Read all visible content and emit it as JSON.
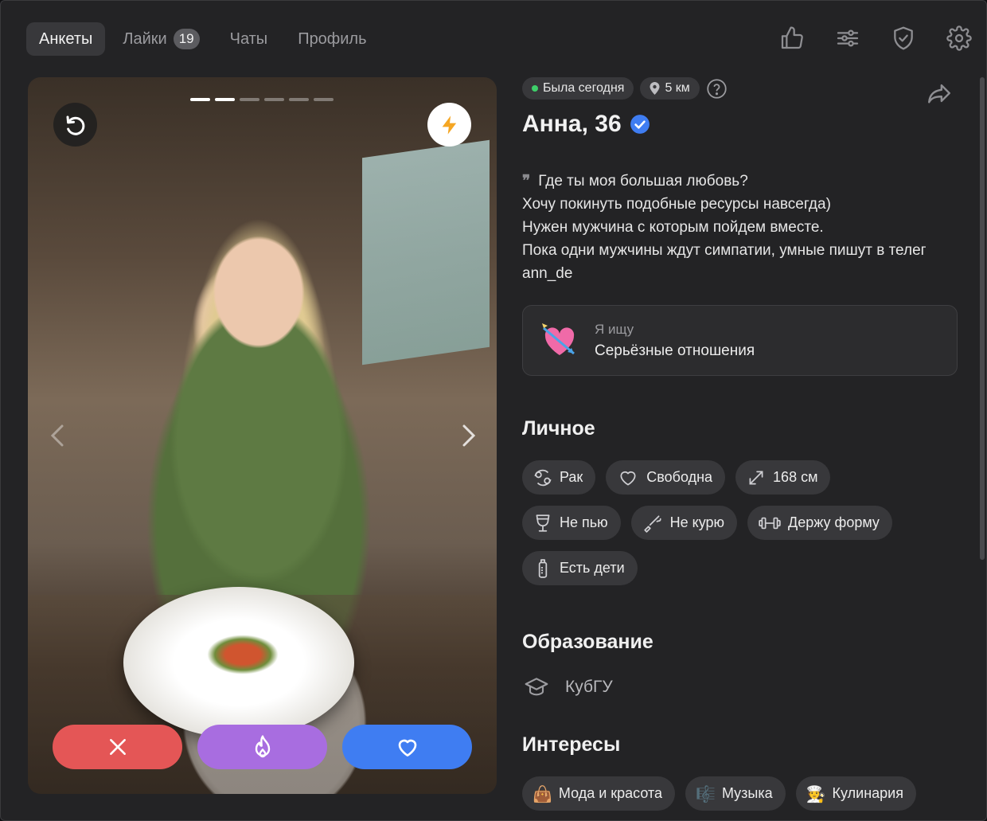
{
  "nav": {
    "tabs": [
      {
        "label": "Анкеты"
      },
      {
        "label": "Лайки",
        "badge": "19"
      },
      {
        "label": "Чаты"
      },
      {
        "label": "Профиль"
      }
    ],
    "icons": [
      "thumbs-up-icon",
      "sliders-icon",
      "shield-check-icon",
      "gear-icon"
    ]
  },
  "photo": {
    "count": 6,
    "current": 2
  },
  "profile": {
    "status": "Была сегодня",
    "distance": "5 км",
    "name": "Анна, 36",
    "verified": true,
    "bio": [
      "Где ты моя большая любовь?",
      "Хочу покинуть подобные ресурсы навсегда)",
      "Нужен мужчина с которым пойдем вместе.",
      "Пока одни мужчины ждут симпатии, умные пишут в телег",
      "ann_de"
    ],
    "seeking": {
      "label": "Я ищу",
      "value": "Серьёзные отношения"
    }
  },
  "personal": {
    "title": "Личное",
    "items": [
      {
        "label": "Рак",
        "icon": "zodiac-cancer-icon"
      },
      {
        "label": "Свободна",
        "icon": "heart-icon"
      },
      {
        "label": "168 см",
        "icon": "height-arrows-icon"
      },
      {
        "label": "Не пью",
        "icon": "glass-icon"
      },
      {
        "label": "Не курю",
        "icon": "no-smoking-icon"
      },
      {
        "label": "Держу форму",
        "icon": "dumbbell-icon"
      },
      {
        "label": "Есть дети",
        "icon": "baby-bottle-icon"
      }
    ]
  },
  "education": {
    "title": "Образование",
    "value": "КубГУ"
  },
  "interests": {
    "title": "Интересы",
    "items": [
      {
        "label": "Мода и красота",
        "emoji": "👜"
      },
      {
        "label": "Музыка",
        "emoji": "🎼"
      },
      {
        "label": "Кулинария",
        "emoji": "🧑‍🍳"
      }
    ]
  },
  "colors": {
    "background": "#232325",
    "chip": "#38383b",
    "pass": "#e45656",
    "superlike": "#a86de0",
    "like": "#3f7df2",
    "online": "#3ecf6a",
    "verified": "#3f7df2"
  }
}
